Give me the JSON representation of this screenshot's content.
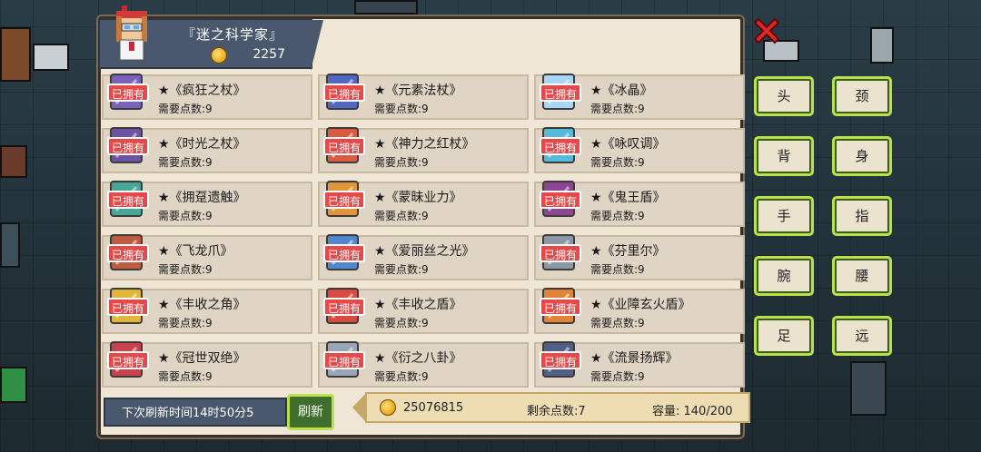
{
  "header": {
    "title": "『迷之科学家』",
    "gold": "2257"
  },
  "owned_badge": "已拥有",
  "items": [
    {
      "name": "★《疯狂之杖》",
      "cost": "需要点数:9",
      "icon": "staff-icon",
      "color": "#6b4fbf"
    },
    {
      "name": "★《元素法杖》",
      "cost": "需要点数:9",
      "icon": "staff-icon",
      "color": "#3a53c4"
    },
    {
      "name": "★《冰晶》",
      "cost": "需要点数:9",
      "icon": "crystal-icon",
      "color": "#9fd7ff"
    },
    {
      "name": "★《时光之杖》",
      "cost": "需要点数:9",
      "icon": "staff-icon",
      "color": "#5a3d9e"
    },
    {
      "name": "★《神力之红杖》",
      "cost": "需要点数:9",
      "icon": "staff-icon",
      "color": "#d9462b"
    },
    {
      "name": "★《咏叹调》",
      "cost": "需要点数:9",
      "icon": "scepter-icon",
      "color": "#3fb6e0"
    },
    {
      "name": "★《拥趸遗触》",
      "cost": "需要点数:9",
      "icon": "tentacle-icon",
      "color": "#2e9f8f"
    },
    {
      "name": "★《蒙昧业力》",
      "cost": "需要点数:9",
      "icon": "staff-icon",
      "color": "#e08a22"
    },
    {
      "name": "★《鬼王盾》",
      "cost": "需要点数:9",
      "icon": "shield-icon",
      "color": "#7a2f8a"
    },
    {
      "name": "★《飞龙爪》",
      "cost": "需要点数:9",
      "icon": "claw-icon",
      "color": "#b8472a"
    },
    {
      "name": "★《爱丽丝之光》",
      "cost": "需要点数:9",
      "icon": "gem-icon",
      "color": "#3a7ad0"
    },
    {
      "name": "★《芬里尔》",
      "cost": "需要点数:9",
      "icon": "shield-icon",
      "color": "#7d8ea0"
    },
    {
      "name": "★《丰收之角》",
      "cost": "需要点数:9",
      "icon": "horn-icon",
      "color": "#e0b21f"
    },
    {
      "name": "★《丰收之盾》",
      "cost": "需要点数:9",
      "icon": "shield-icon",
      "color": "#d8342c"
    },
    {
      "name": "★《业障玄火盾》",
      "cost": "需要点数:9",
      "icon": "shield-icon",
      "color": "#e0781f"
    },
    {
      "name": "★《冠世双绝》",
      "cost": "需要点数:9",
      "icon": "mushroom-icon",
      "color": "#c8283a"
    },
    {
      "name": "★《衍之八卦》",
      "cost": "需要点数:9",
      "icon": "bagua-icon",
      "color": "#8e9db6"
    },
    {
      "name": "★《流景扬辉》",
      "cost": "需要点数:9",
      "icon": "shield-icon",
      "color": "#3b4a7a"
    }
  ],
  "bottom": {
    "refresh_time": "下次刷新时间14时50分5",
    "refresh_label": "刷新",
    "money": "25076815",
    "points": "剩余点数:7",
    "capacity": "容量:  140/200"
  },
  "categories": [
    "头",
    "颈",
    "背",
    "身",
    "手",
    "指",
    "腕",
    "腰",
    "足",
    "远"
  ]
}
